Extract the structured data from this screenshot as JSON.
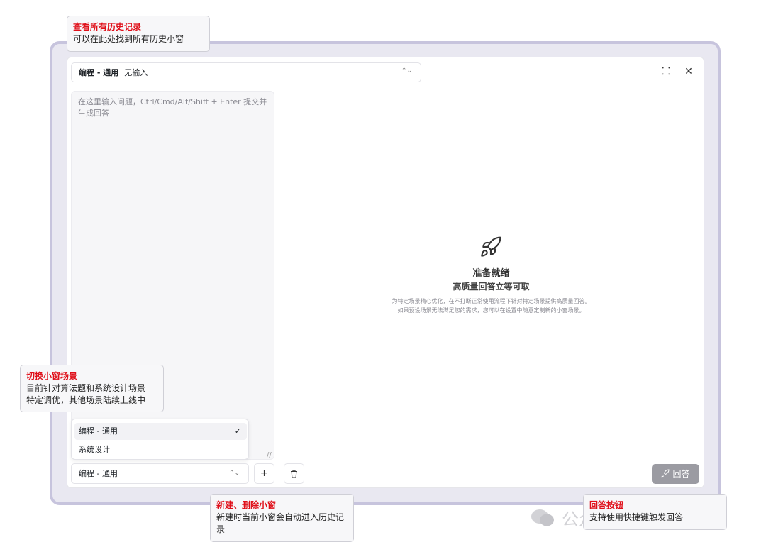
{
  "window": {
    "scene_selector": {
      "bold": "编程 - 通用",
      "value": "无输入"
    },
    "controls": {
      "collapse_symbol": "⸬",
      "close_symbol": "✕"
    }
  },
  "input": {
    "placeholder": "在这里输入问题，Ctrl/Cmd/Alt/Shift + Enter 提交并生成回答"
  },
  "empty_state": {
    "title": "准备就绪",
    "subtitle": "高质量回答立等可取",
    "desc_line1": "为特定场景精心优化，在不打断正常使用流程下针对特定场景提供高质量回答。",
    "desc_line2": "如果预设场景无法满足您的需求，您可以在设置中随意定制新的小窗场景。"
  },
  "dropdown": {
    "options": [
      {
        "label": "编程 - 通用",
        "selected": true,
        "check": "✓"
      },
      {
        "label": "系统设计",
        "selected": false
      }
    ]
  },
  "bottom_bar": {
    "scene_value": "编程 - 通用",
    "add_symbol": "+",
    "answer_label": "回答"
  },
  "callouts": {
    "history": {
      "title": "查看所有历史记录",
      "body": "可以在此处找到所有历史小窗"
    },
    "scene": {
      "title": "切换小窗场景",
      "body_line1": "目前针对算法题和系统设计场景",
      "body_line2": "特定调优，其他场景陆续上线中"
    },
    "new_delete": {
      "title": "新建、删除小窗",
      "body": "新建时当前小窗会自动进入历史记录"
    },
    "answer": {
      "title": "回答按钮",
      "body": "支持使用快捷键触发回答"
    }
  },
  "watermark": {
    "text": "公众号 · 网事随言"
  },
  "colors": {
    "accent_red": "#e0101a",
    "answer_button": "#9b9ba2",
    "frame": "#c7c4dd"
  }
}
